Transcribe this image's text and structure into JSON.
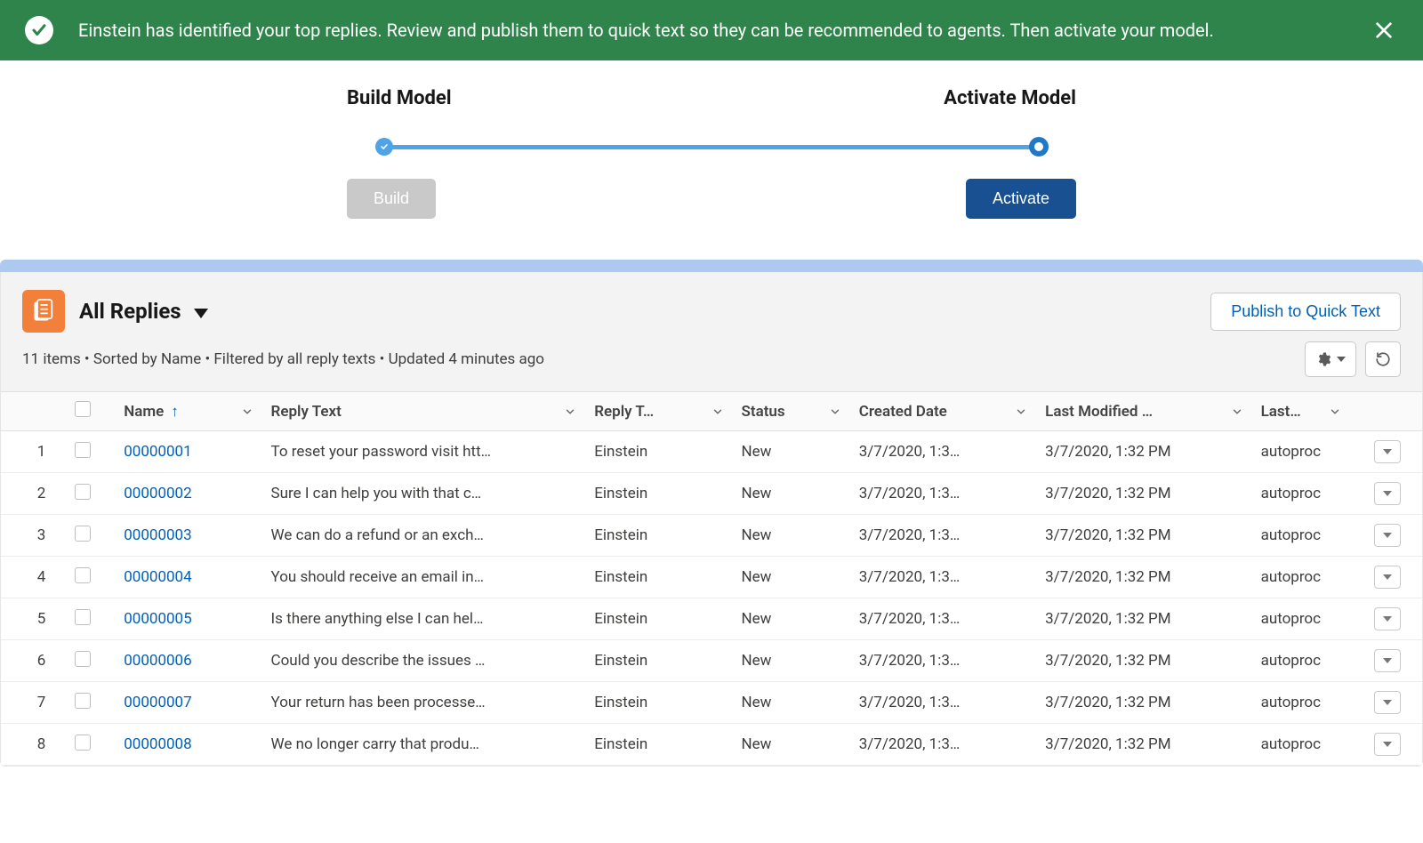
{
  "banner": {
    "message": "Einstein has identified your top replies. Review and publish them to quick text so they can be recommended to agents. Then activate your model."
  },
  "stage": {
    "left_label": "Build Model",
    "right_label": "Activate Model",
    "build_button": "Build",
    "activate_button": "Activate"
  },
  "list": {
    "title": "All Replies",
    "publish_button": "Publish to Quick Text",
    "meta": "11 items • Sorted by Name • Filtered by all reply texts • Updated 4 minutes ago"
  },
  "columns": {
    "name": "Name",
    "reply_text": "Reply Text",
    "reply_type": "Reply T…",
    "status": "Status",
    "created": "Created Date",
    "modified": "Last Modified …",
    "last": "Last…"
  },
  "rows": [
    {
      "num": "1",
      "name": "00000001",
      "reply": "To reset your password visit htt…",
      "type": "Einstein",
      "status": "New",
      "created": "3/7/2020, 1:3…",
      "modified": "3/7/2020, 1:32 PM",
      "last": "autoproc"
    },
    {
      "num": "2",
      "name": "00000002",
      "reply": "Sure I can help you with that c…",
      "type": "Einstein",
      "status": "New",
      "created": "3/7/2020, 1:3…",
      "modified": "3/7/2020, 1:32 PM",
      "last": "autoproc"
    },
    {
      "num": "3",
      "name": "00000003",
      "reply": "We can do a refund or an exch…",
      "type": "Einstein",
      "status": "New",
      "created": "3/7/2020, 1:3…",
      "modified": "3/7/2020, 1:32 PM",
      "last": "autoproc"
    },
    {
      "num": "4",
      "name": "00000004",
      "reply": "You should receive an email in…",
      "type": "Einstein",
      "status": "New",
      "created": "3/7/2020, 1:3…",
      "modified": "3/7/2020, 1:32 PM",
      "last": "autoproc"
    },
    {
      "num": "5",
      "name": "00000005",
      "reply": "Is there anything else I can hel…",
      "type": "Einstein",
      "status": "New",
      "created": "3/7/2020, 1:3…",
      "modified": "3/7/2020, 1:32 PM",
      "last": "autoproc"
    },
    {
      "num": "6",
      "name": "00000006",
      "reply": "Could you describe the issues …",
      "type": "Einstein",
      "status": "New",
      "created": "3/7/2020, 1:3…",
      "modified": "3/7/2020, 1:32 PM",
      "last": "autoproc"
    },
    {
      "num": "7",
      "name": "00000007",
      "reply": "Your return has been processe…",
      "type": "Einstein",
      "status": "New",
      "created": "3/7/2020, 1:3…",
      "modified": "3/7/2020, 1:32 PM",
      "last": "autoproc"
    },
    {
      "num": "8",
      "name": "00000008",
      "reply": "We no longer carry that produ…",
      "type": "Einstein",
      "status": "New",
      "created": "3/7/2020, 1:3…",
      "modified": "3/7/2020, 1:32 PM",
      "last": "autoproc"
    }
  ]
}
